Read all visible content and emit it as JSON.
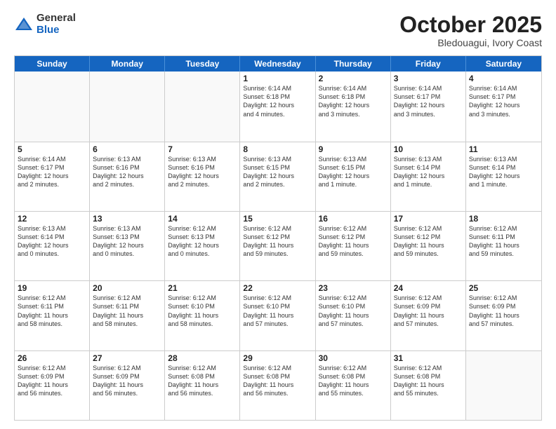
{
  "logo": {
    "general": "General",
    "blue": "Blue"
  },
  "title": "October 2025",
  "location": "Bledouagui, Ivory Coast",
  "header_days": [
    "Sunday",
    "Monday",
    "Tuesday",
    "Wednesday",
    "Thursday",
    "Friday",
    "Saturday"
  ],
  "weeks": [
    [
      {
        "day": "",
        "info": ""
      },
      {
        "day": "",
        "info": ""
      },
      {
        "day": "",
        "info": ""
      },
      {
        "day": "1",
        "info": "Sunrise: 6:14 AM\nSunset: 6:18 PM\nDaylight: 12 hours\nand 4 minutes."
      },
      {
        "day": "2",
        "info": "Sunrise: 6:14 AM\nSunset: 6:18 PM\nDaylight: 12 hours\nand 3 minutes."
      },
      {
        "day": "3",
        "info": "Sunrise: 6:14 AM\nSunset: 6:17 PM\nDaylight: 12 hours\nand 3 minutes."
      },
      {
        "day": "4",
        "info": "Sunrise: 6:14 AM\nSunset: 6:17 PM\nDaylight: 12 hours\nand 3 minutes."
      }
    ],
    [
      {
        "day": "5",
        "info": "Sunrise: 6:14 AM\nSunset: 6:17 PM\nDaylight: 12 hours\nand 2 minutes."
      },
      {
        "day": "6",
        "info": "Sunrise: 6:13 AM\nSunset: 6:16 PM\nDaylight: 12 hours\nand 2 minutes."
      },
      {
        "day": "7",
        "info": "Sunrise: 6:13 AM\nSunset: 6:16 PM\nDaylight: 12 hours\nand 2 minutes."
      },
      {
        "day": "8",
        "info": "Sunrise: 6:13 AM\nSunset: 6:15 PM\nDaylight: 12 hours\nand 2 minutes."
      },
      {
        "day": "9",
        "info": "Sunrise: 6:13 AM\nSunset: 6:15 PM\nDaylight: 12 hours\nand 1 minute."
      },
      {
        "day": "10",
        "info": "Sunrise: 6:13 AM\nSunset: 6:14 PM\nDaylight: 12 hours\nand 1 minute."
      },
      {
        "day": "11",
        "info": "Sunrise: 6:13 AM\nSunset: 6:14 PM\nDaylight: 12 hours\nand 1 minute."
      }
    ],
    [
      {
        "day": "12",
        "info": "Sunrise: 6:13 AM\nSunset: 6:14 PM\nDaylight: 12 hours\nand 0 minutes."
      },
      {
        "day": "13",
        "info": "Sunrise: 6:13 AM\nSunset: 6:13 PM\nDaylight: 12 hours\nand 0 minutes."
      },
      {
        "day": "14",
        "info": "Sunrise: 6:12 AM\nSunset: 6:13 PM\nDaylight: 12 hours\nand 0 minutes."
      },
      {
        "day": "15",
        "info": "Sunrise: 6:12 AM\nSunset: 6:12 PM\nDaylight: 11 hours\nand 59 minutes."
      },
      {
        "day": "16",
        "info": "Sunrise: 6:12 AM\nSunset: 6:12 PM\nDaylight: 11 hours\nand 59 minutes."
      },
      {
        "day": "17",
        "info": "Sunrise: 6:12 AM\nSunset: 6:12 PM\nDaylight: 11 hours\nand 59 minutes."
      },
      {
        "day": "18",
        "info": "Sunrise: 6:12 AM\nSunset: 6:11 PM\nDaylight: 11 hours\nand 59 minutes."
      }
    ],
    [
      {
        "day": "19",
        "info": "Sunrise: 6:12 AM\nSunset: 6:11 PM\nDaylight: 11 hours\nand 58 minutes."
      },
      {
        "day": "20",
        "info": "Sunrise: 6:12 AM\nSunset: 6:11 PM\nDaylight: 11 hours\nand 58 minutes."
      },
      {
        "day": "21",
        "info": "Sunrise: 6:12 AM\nSunset: 6:10 PM\nDaylight: 11 hours\nand 58 minutes."
      },
      {
        "day": "22",
        "info": "Sunrise: 6:12 AM\nSunset: 6:10 PM\nDaylight: 11 hours\nand 57 minutes."
      },
      {
        "day": "23",
        "info": "Sunrise: 6:12 AM\nSunset: 6:10 PM\nDaylight: 11 hours\nand 57 minutes."
      },
      {
        "day": "24",
        "info": "Sunrise: 6:12 AM\nSunset: 6:09 PM\nDaylight: 11 hours\nand 57 minutes."
      },
      {
        "day": "25",
        "info": "Sunrise: 6:12 AM\nSunset: 6:09 PM\nDaylight: 11 hours\nand 57 minutes."
      }
    ],
    [
      {
        "day": "26",
        "info": "Sunrise: 6:12 AM\nSunset: 6:09 PM\nDaylight: 11 hours\nand 56 minutes."
      },
      {
        "day": "27",
        "info": "Sunrise: 6:12 AM\nSunset: 6:09 PM\nDaylight: 11 hours\nand 56 minutes."
      },
      {
        "day": "28",
        "info": "Sunrise: 6:12 AM\nSunset: 6:08 PM\nDaylight: 11 hours\nand 56 minutes."
      },
      {
        "day": "29",
        "info": "Sunrise: 6:12 AM\nSunset: 6:08 PM\nDaylight: 11 hours\nand 56 minutes."
      },
      {
        "day": "30",
        "info": "Sunrise: 6:12 AM\nSunset: 6:08 PM\nDaylight: 11 hours\nand 55 minutes."
      },
      {
        "day": "31",
        "info": "Sunrise: 6:12 AM\nSunset: 6:08 PM\nDaylight: 11 hours\nand 55 minutes."
      },
      {
        "day": "",
        "info": ""
      }
    ]
  ]
}
